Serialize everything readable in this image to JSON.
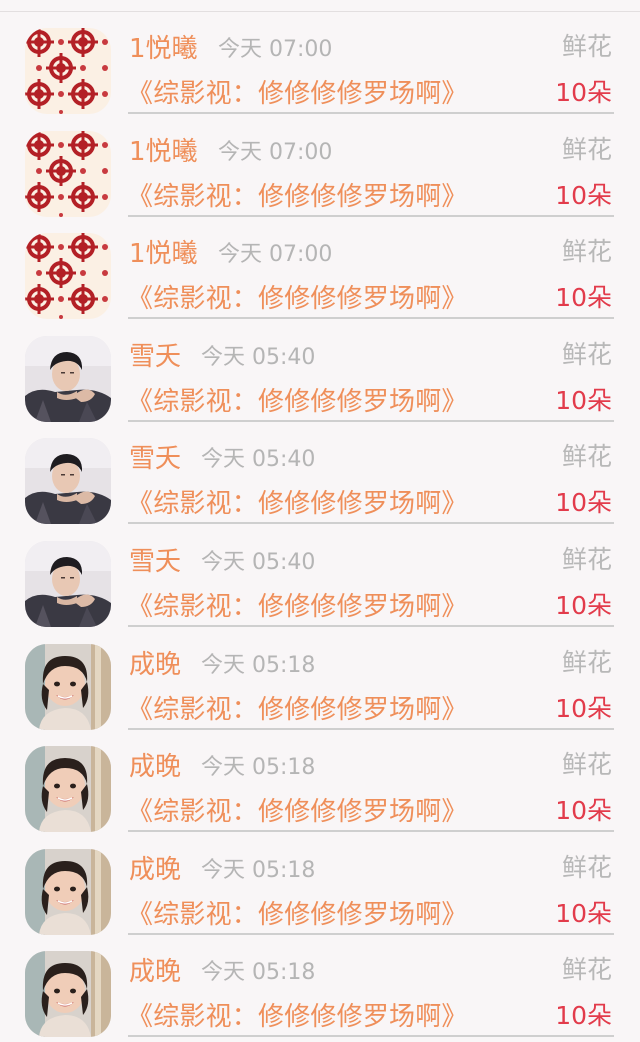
{
  "rows": [
    {
      "name": "1悦曦",
      "time": "今天 07:00",
      "gift": "鲜花",
      "message": "《综影视：修修修修罗场啊》",
      "count": "10朵",
      "avatar": "paper-cut-pattern-icon"
    },
    {
      "name": "1悦曦",
      "time": "今天 07:00",
      "gift": "鲜花",
      "message": "《综影视：修修修修罗场啊》",
      "count": "10朵",
      "avatar": "paper-cut-pattern-icon"
    },
    {
      "name": "1悦曦",
      "time": "今天 07:00",
      "gift": "鲜花",
      "message": "《综影视：修修修修罗场啊》",
      "count": "10朵",
      "avatar": "paper-cut-pattern-icon"
    },
    {
      "name": "雪夭",
      "time": "今天 05:40",
      "gift": "鲜花",
      "message": "《综影视：修修修修罗场啊》",
      "count": "10朵",
      "avatar": "man-portrait-photo"
    },
    {
      "name": "雪夭",
      "time": "今天 05:40",
      "gift": "鲜花",
      "message": "《综影视：修修修修罗场啊》",
      "count": "10朵",
      "avatar": "man-portrait-photo"
    },
    {
      "name": "雪夭",
      "time": "今天 05:40",
      "gift": "鲜花",
      "message": "《综影视：修修修修罗场啊》",
      "count": "10朵",
      "avatar": "man-portrait-photo"
    },
    {
      "name": "成晚",
      "time": "今天 05:18",
      "gift": "鲜花",
      "message": "《综影视：修修修修罗场啊》",
      "count": "10朵",
      "avatar": "girl-portrait-photo"
    },
    {
      "name": "成晚",
      "time": "今天 05:18",
      "gift": "鲜花",
      "message": "《综影视：修修修修罗场啊》",
      "count": "10朵",
      "avatar": "girl-portrait-photo"
    },
    {
      "name": "成晚",
      "time": "今天 05:18",
      "gift": "鲜花",
      "message": "《综影视：修修修修罗场啊》",
      "count": "10朵",
      "avatar": "girl-portrait-photo"
    },
    {
      "name": "成晚",
      "time": "今天 05:18",
      "gift": "鲜花",
      "message": "《综影视：修修修修罗场啊》",
      "count": "10朵",
      "avatar": "girl-portrait-photo"
    }
  ],
  "colors": {
    "name": "#ef8f5a",
    "message": "#ef8f5a",
    "count": "#e23b4b",
    "muted": "#b5b5b5",
    "background": "#f9f6f7"
  }
}
